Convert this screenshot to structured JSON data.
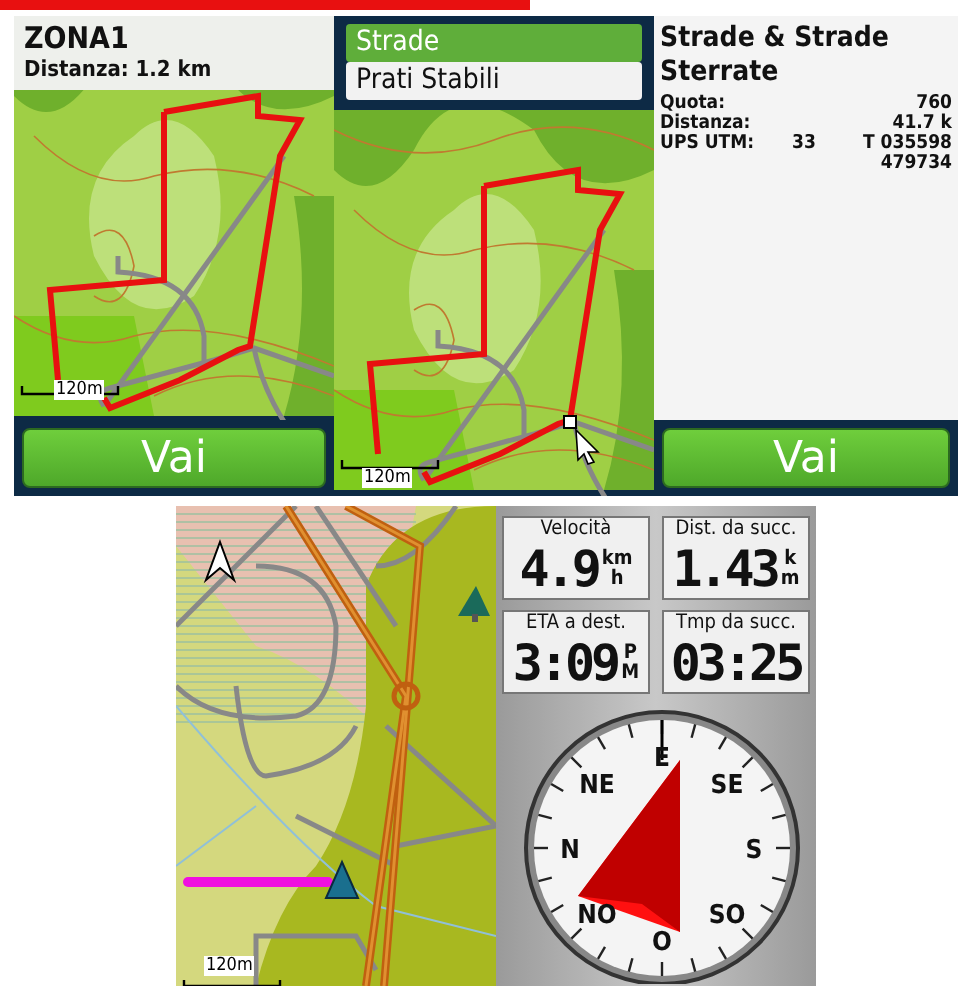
{
  "route_screen": {
    "title": "ZONA1",
    "distance": "Distanza: 1.2 km",
    "scale": "120m",
    "button": "Vai"
  },
  "menu_screen": {
    "menu": [
      {
        "label": "Strade",
        "selected": true
      },
      {
        "label": "Prati Stabili",
        "selected": false
      }
    ],
    "scale": "120m"
  },
  "info_screen": {
    "title": "Strade & Strade Sterrate",
    "rows": [
      {
        "label": "Quota:",
        "value": "760"
      },
      {
        "label": "Distanza:",
        "value": "41.7 k"
      },
      {
        "label": "UPS UTM:",
        "zone": "33",
        "value": "T 035598",
        "value_2": "479734"
      }
    ],
    "button": "Vai"
  },
  "map_screen": {
    "scale": "120m"
  },
  "trip_screen": {
    "fields": [
      {
        "label": "Velocità",
        "value": "4.9",
        "unit_top": "km",
        "unit_bottom": "h"
      },
      {
        "label": "Dist. da succ.",
        "value": "1.43",
        "unit_top": "k",
        "unit_bottom": "m"
      },
      {
        "label": "ETA a dest.",
        "value": "3:09",
        "unit_top": "P",
        "unit_bottom": "M"
      },
      {
        "label": "Tmp da succ.",
        "value": "03:25"
      }
    ],
    "compass": {
      "labels": [
        "N",
        "NE",
        "E",
        "SE",
        "S",
        "SO",
        "O",
        "NO"
      ]
    }
  }
}
